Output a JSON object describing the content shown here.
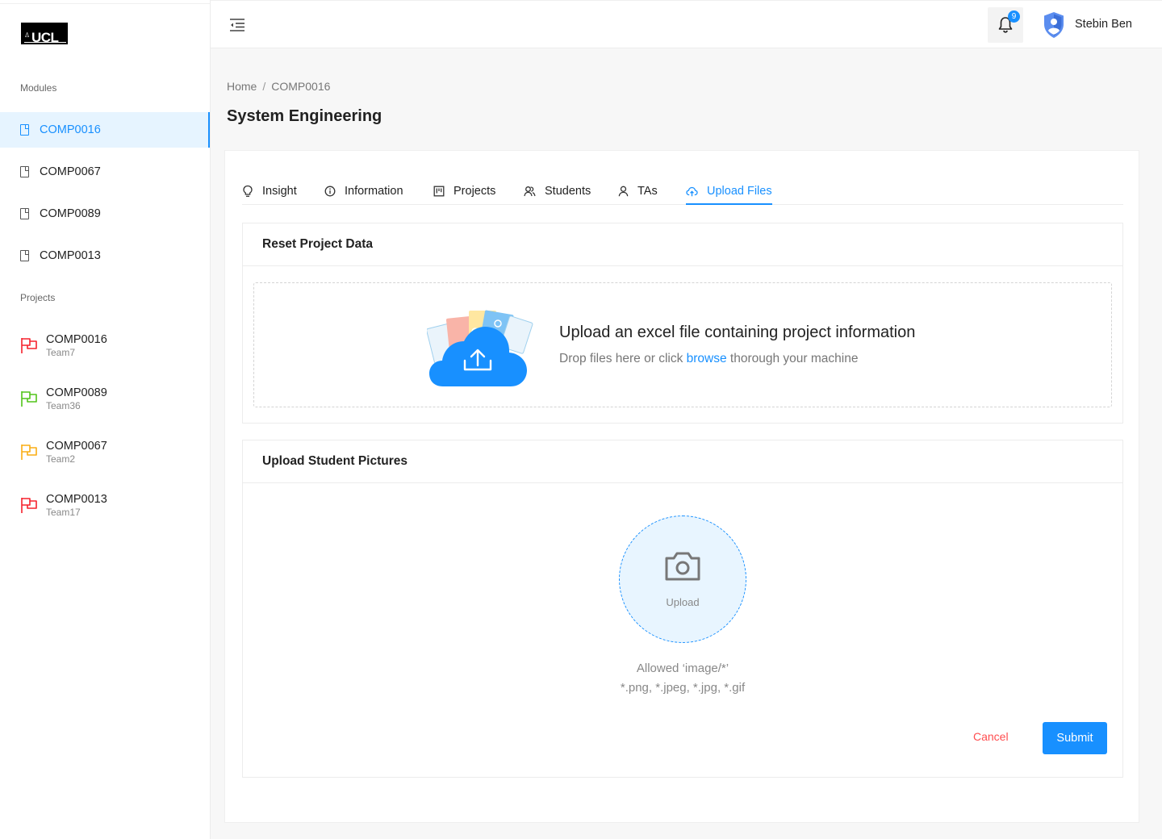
{
  "brand": {
    "logo_text": "UCL",
    "logo_crest": "♙"
  },
  "sidebar": {
    "modules_label": "Modules",
    "modules": [
      {
        "label": "COMP0016",
        "active": true
      },
      {
        "label": "COMP0067",
        "active": false
      },
      {
        "label": "COMP0089",
        "active": false
      },
      {
        "label": "COMP0013",
        "active": false
      }
    ],
    "projects_label": "Projects",
    "projects": [
      {
        "code": "COMP0016",
        "team": "Team7",
        "flag_color": "#f5222d"
      },
      {
        "code": "COMP0089",
        "team": "Team36",
        "flag_color": "#52c41a"
      },
      {
        "code": "COMP0067",
        "team": "Team2",
        "flag_color": "#faad14"
      },
      {
        "code": "COMP0013",
        "team": "Team17",
        "flag_color": "#f5222d"
      }
    ]
  },
  "header": {
    "notification_count": "9",
    "user_name": "Stebin Ben"
  },
  "breadcrumb": {
    "home": "Home",
    "separator": "/",
    "current": "COMP0016"
  },
  "page": {
    "title": "System Engineering"
  },
  "tabs": [
    {
      "label": "Insight",
      "icon": "bulb-icon",
      "active": false
    },
    {
      "label": "Information",
      "icon": "info-circle-icon",
      "active": false
    },
    {
      "label": "Projects",
      "icon": "project-board-icon",
      "active": false
    },
    {
      "label": "Students",
      "icon": "users-icon",
      "active": false
    },
    {
      "label": "TAs",
      "icon": "user-icon",
      "active": false
    },
    {
      "label": "Upload Files",
      "icon": "cloud-upload-icon",
      "active": true
    }
  ],
  "reset_panel": {
    "title": "Reset Project Data",
    "dropzone_title": "Upload an excel file containing project information",
    "dropzone_text_before": "Drop files here or click ",
    "dropzone_link": "browse",
    "dropzone_text_after": " thorough your machine"
  },
  "pictures_panel": {
    "title": "Upload Student Pictures",
    "upload_label": "Upload",
    "allowed_line1": "Allowed ‘image/*’",
    "allowed_line2": "*.png, *.jpeg, *.jpg, *.gif",
    "cancel_label": "Cancel",
    "submit_label": "Submit"
  },
  "colors": {
    "primary": "#1890ff",
    "danger": "#ff4d4f",
    "active_bg": "#e6f4ff",
    "upload_circle_bg": "#e8f5ff"
  }
}
